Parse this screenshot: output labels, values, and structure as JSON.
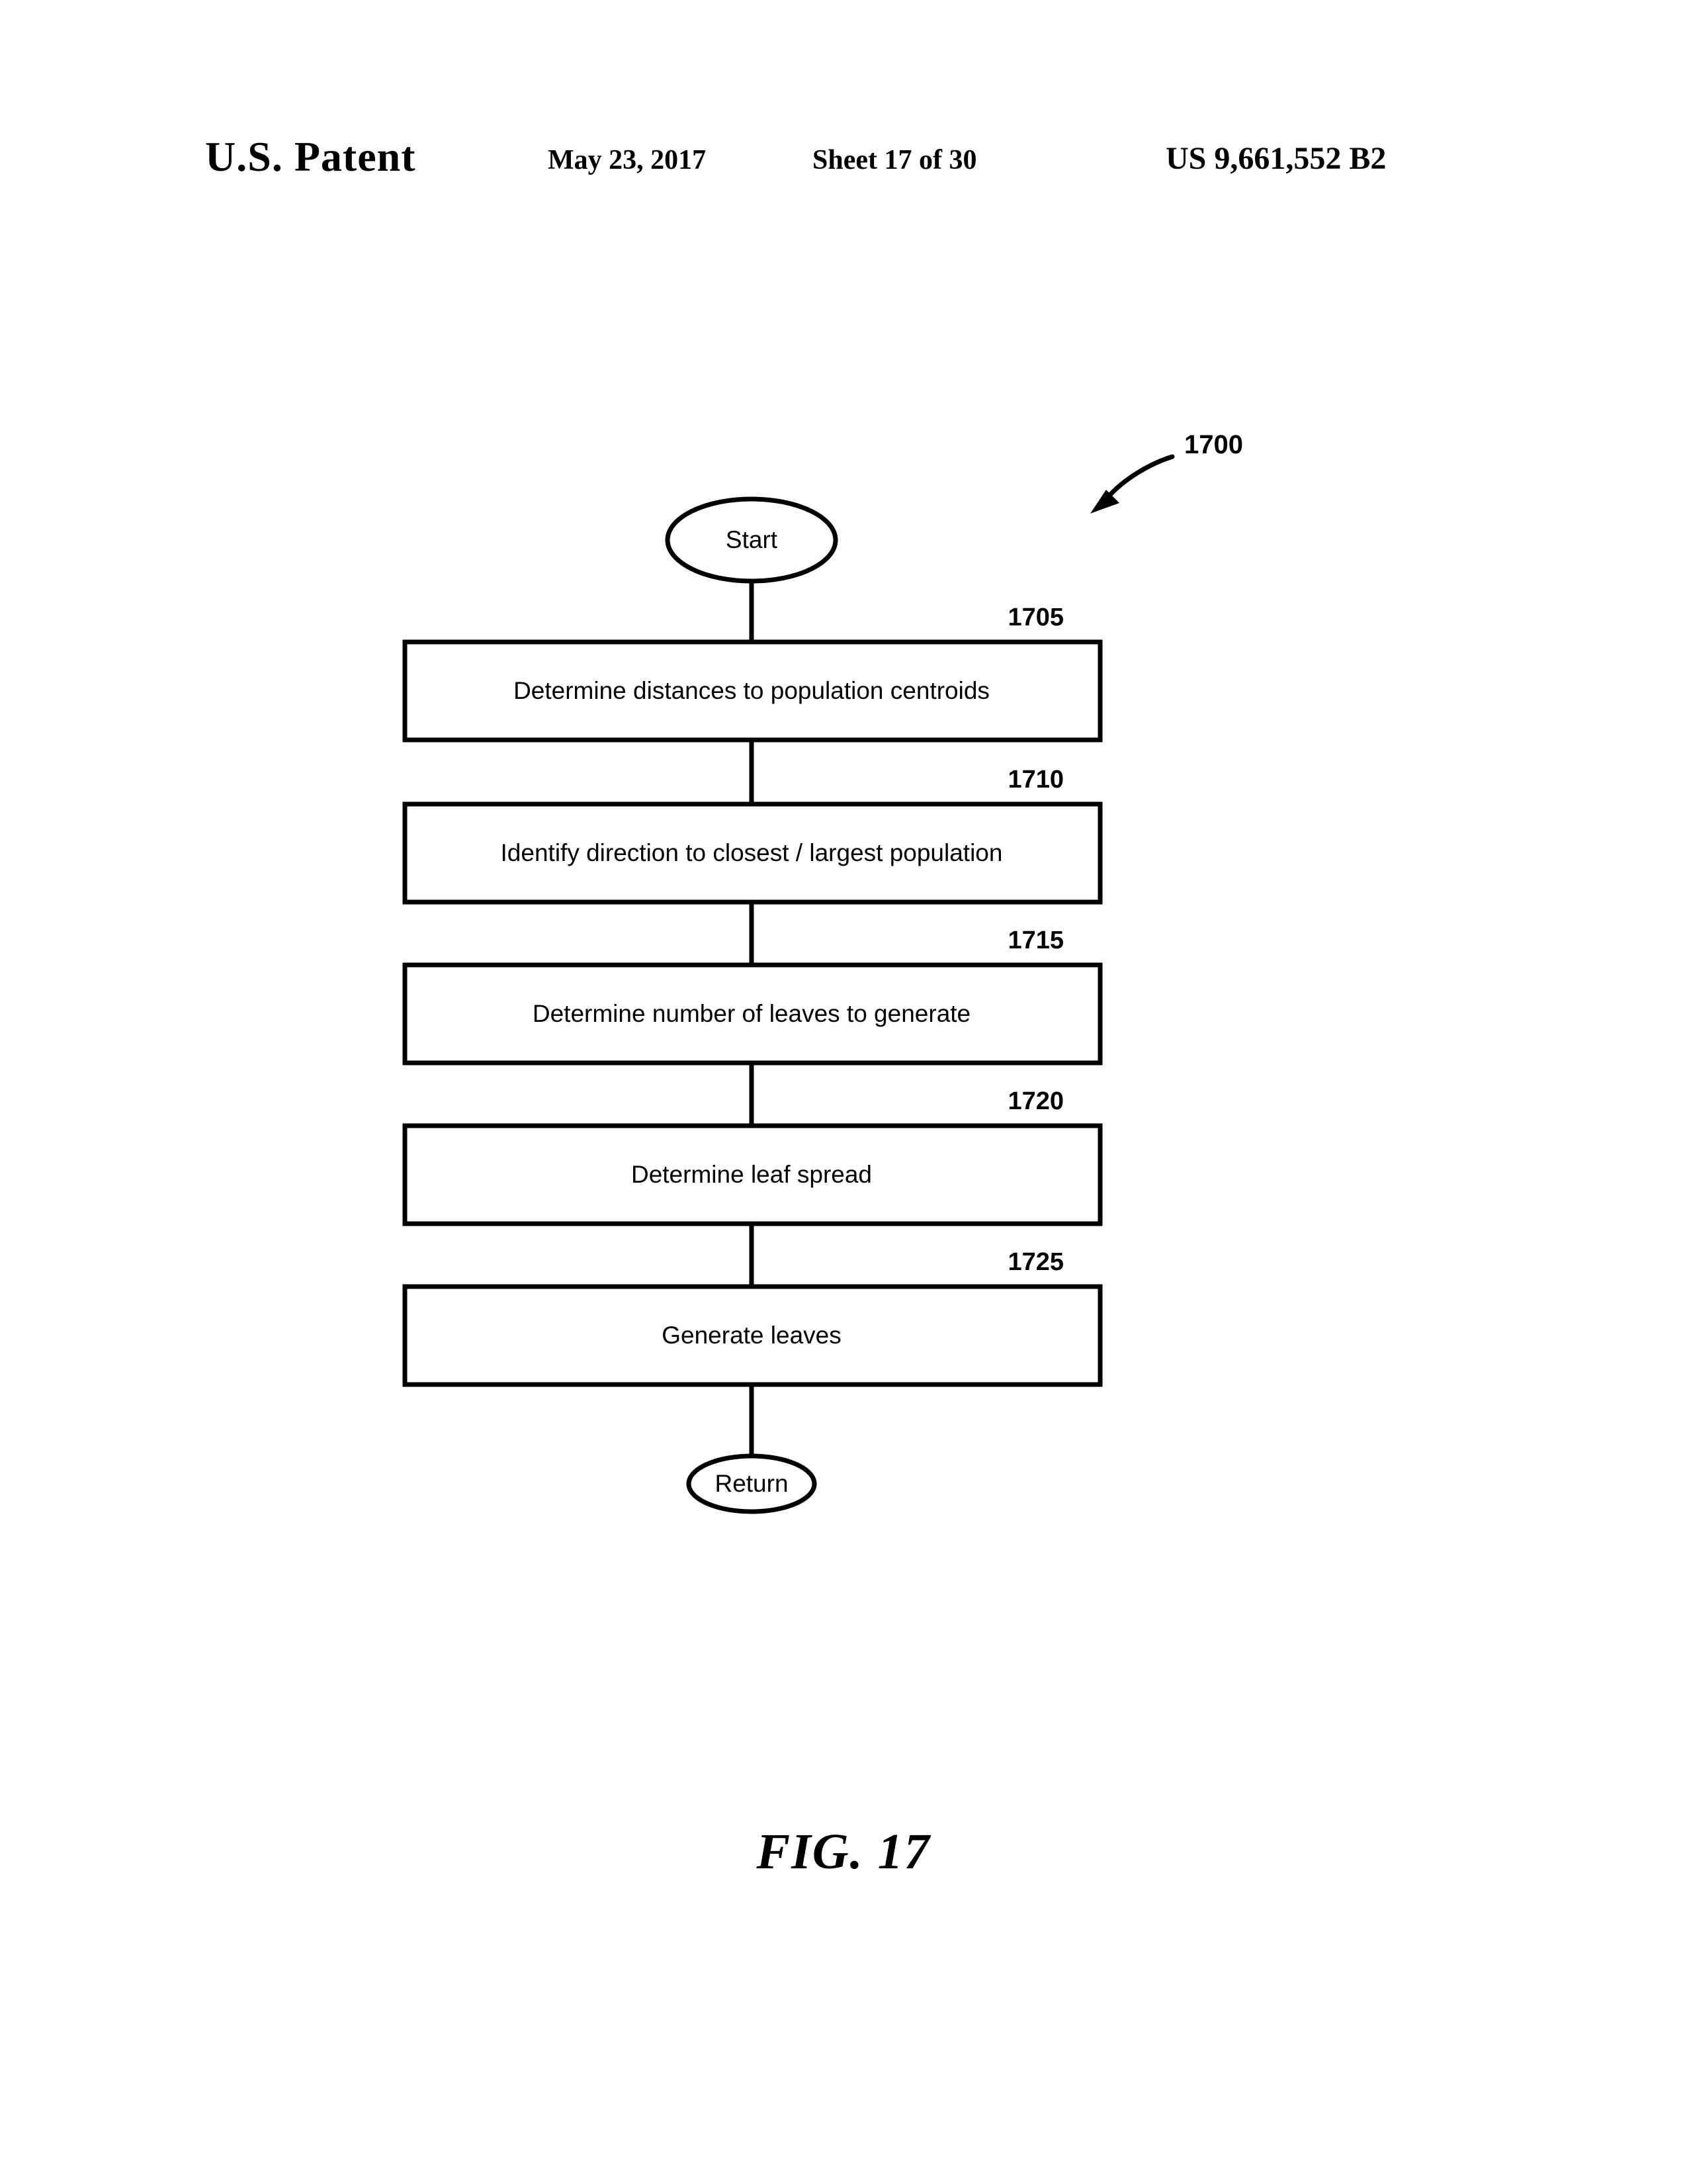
{
  "header": {
    "title": "U.S. Patent",
    "date": "May 23, 2017",
    "sheet": "Sheet 17 of 30",
    "patent_number": "US 9,661,552 B2"
  },
  "figure": {
    "caption": "FIG. 17",
    "diagram_reference": "1700"
  },
  "flowchart": {
    "type": "flowchart",
    "start_label": "Start",
    "end_label": "Return",
    "steps": [
      {
        "ref": "1705",
        "label": "Determine distances to population centroids"
      },
      {
        "ref": "1710",
        "label": "Identify direction to closest / largest population"
      },
      {
        "ref": "1715",
        "label": "Determine number of leaves to generate"
      },
      {
        "ref": "1720",
        "label": "Determine leaf spread"
      },
      {
        "ref": "1725",
        "label": "Generate leaves"
      }
    ],
    "colors": {
      "stroke": "#000000",
      "fill": "#ffffff",
      "text": "#000000"
    }
  }
}
